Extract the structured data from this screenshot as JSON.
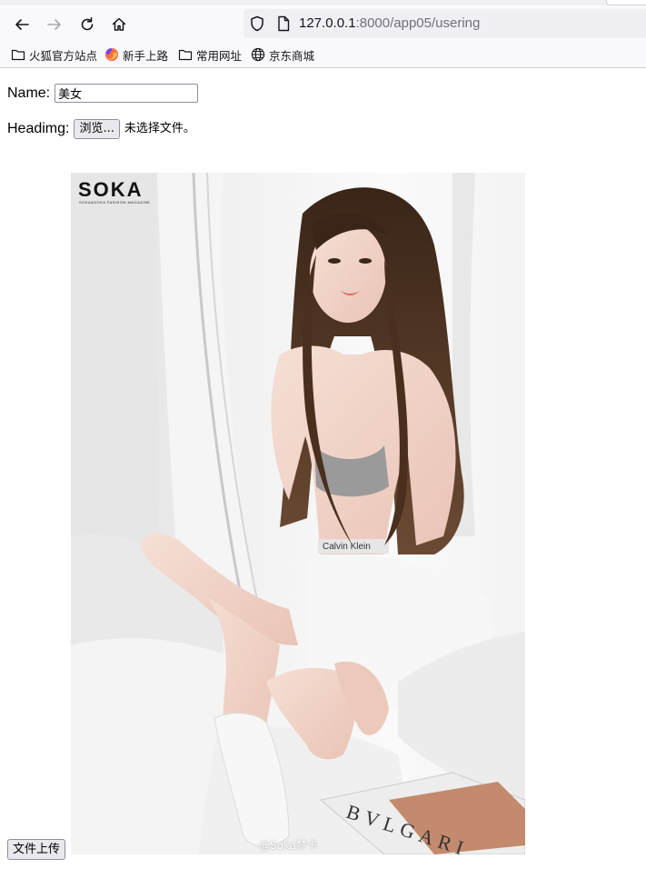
{
  "browser": {
    "url_host": "127.0.0.1",
    "url_path": ":8000/app05/usering",
    "bookmarks": [
      {
        "label": "火狐官方站点",
        "icon": "folder-icon"
      },
      {
        "label": "新手上路",
        "icon": "firefox-icon"
      },
      {
        "label": "常用网址",
        "icon": "folder-icon"
      },
      {
        "label": "京东商城",
        "icon": "globe-icon"
      }
    ]
  },
  "form": {
    "name_label": "Name:",
    "name_value": "美女",
    "headimg_label": "Headimg:",
    "browse_label": "浏览...",
    "file_status": "未选择文件。",
    "submit_label": "文件上传"
  },
  "photo": {
    "logo": "SOKA",
    "logo_sub": "SOKA&SOKA FASHION MAGAZINE",
    "band_text": "Calvin Klein",
    "magazine_text": "BVLGARI",
    "watermark": "@Soka梦卡"
  },
  "colors": {
    "chrome_bg": "#f9f9fb",
    "urlbar_bg": "#f0f0f4",
    "button_bg": "#e9e9ed"
  }
}
